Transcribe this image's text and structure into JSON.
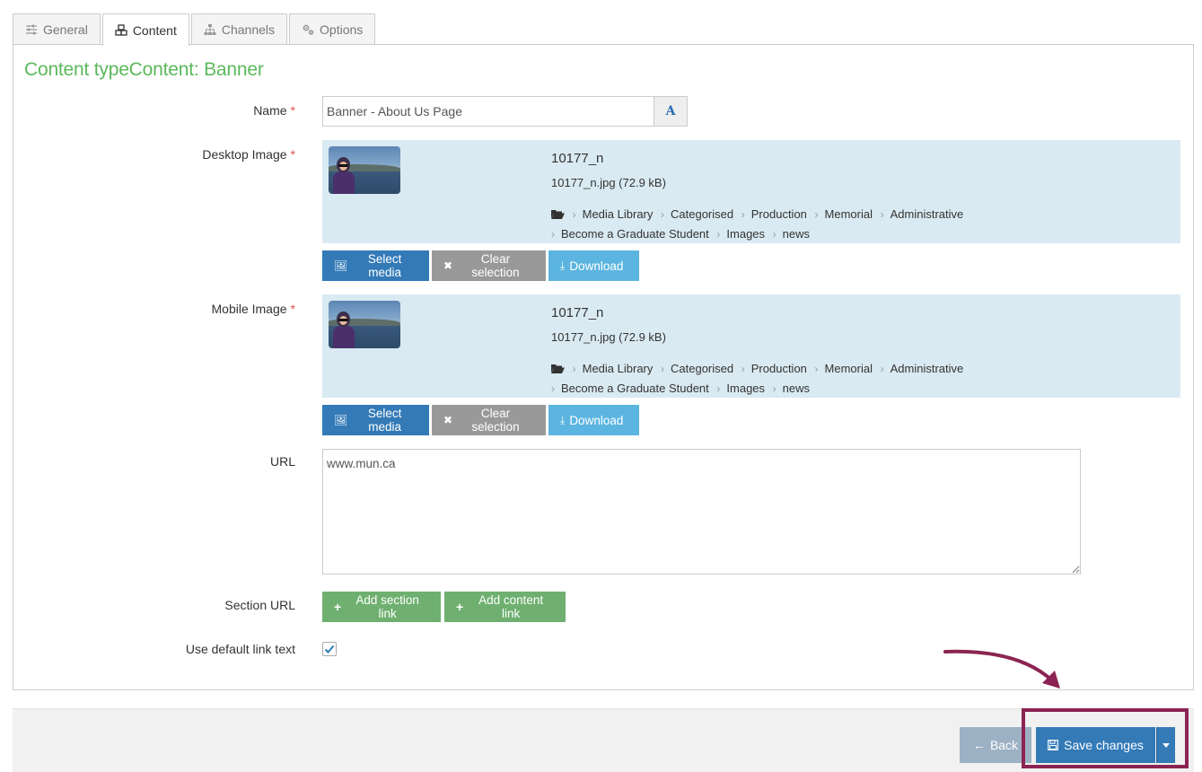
{
  "tabs": [
    {
      "label": "General",
      "icon": "sliders-icon",
      "active": false
    },
    {
      "label": "Content",
      "icon": "cubes-icon",
      "active": true
    },
    {
      "label": "Channels",
      "icon": "sitemap-icon",
      "active": false
    },
    {
      "label": "Options",
      "icon": "cogs-icon",
      "active": false
    }
  ],
  "panel": {
    "title": "Content typeContent: Banner"
  },
  "form": {
    "name": {
      "label": "Name",
      "required": "*",
      "value": "Banner - About Us Page",
      "lang_button": "A"
    },
    "desktop_image": {
      "label": "Desktop Image",
      "required": "*",
      "title": "10177_n",
      "file": "10177_n.jpg (72.9 kB)",
      "path": [
        "Media Library",
        "Categorised",
        "Production",
        "Memorial",
        "Administrative",
        "Become a Graduate Student",
        "Images",
        "news"
      ],
      "buttons": {
        "select": "Select media",
        "clear": "Clear selection",
        "download": "Download"
      }
    },
    "mobile_image": {
      "label": "Mobile Image",
      "required": "*",
      "title": "10177_n",
      "file": "10177_n.jpg (72.9 kB)",
      "path": [
        "Media Library",
        "Categorised",
        "Production",
        "Memorial",
        "Administrative",
        "Become a Graduate Student",
        "Images",
        "news"
      ],
      "buttons": {
        "select": "Select media",
        "clear": "Clear selection",
        "download": "Download"
      }
    },
    "url": {
      "label": "URL",
      "value": "www.mun.ca"
    },
    "section_url": {
      "label": "Section URL",
      "add_section": "Add section link",
      "add_content": "Add content link"
    },
    "default_link_text": {
      "label": "Use default link text",
      "checked": true
    }
  },
  "footer": {
    "back": "Back",
    "save": "Save changes"
  },
  "colors": {
    "title_green": "#5cb85c",
    "primary": "#337ab7",
    "highlight": "#8b2452",
    "media_bg": "#daeaf2"
  }
}
